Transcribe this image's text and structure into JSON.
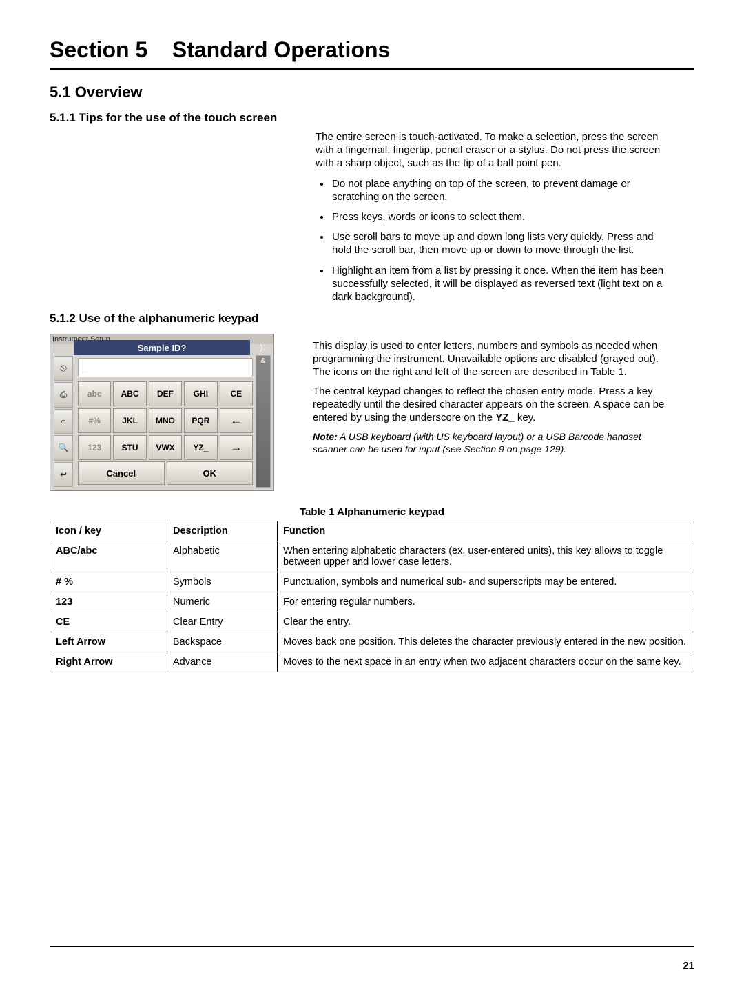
{
  "title_section": "Section 5",
  "title_main": "Standard Operations",
  "h1": "5.1  Overview",
  "s511": {
    "h": "5.1.1  Tips for the use of the touch screen",
    "p1": "The entire screen is touch-activated. To make a selection, press the screen with a fingernail, fingertip, pencil eraser or a stylus. Do not press the screen with a sharp object, such as the tip of a ball point pen.",
    "li1": "Do not place anything on top of the screen, to prevent damage or scratching on the screen.",
    "li2": "Press keys, words or icons to select them.",
    "li3": "Use scroll bars to move up and down long lists very quickly. Press and hold the scroll bar, then move up or down to move through the list.",
    "li4": "Highlight an item from a list by pressing it once. When the item has been successfully selected, it will be displayed as reversed text (light text on a dark background)."
  },
  "s512": {
    "h": "5.1.2  Use of the alphanumeric keypad",
    "p1": "This display is used to enter letters, numbers and symbols as needed when programming the instrument. Unavailable options are disabled (grayed out). The icons on the right and left of the screen are described in Table 1.",
    "p2a": "The central keypad changes to reflect the chosen entry mode. Press a key repeatedly until the desired character appears on the screen. A space can be entered by using the underscore on the ",
    "p2b": "YZ_",
    "p2c": " key.",
    "note_lead": "Note:",
    "note_body": " A USB keyboard (with US keyboard layout) or a USB Barcode handset scanner can be used for input (see Section 9 on page 129)."
  },
  "keypad": {
    "scrim": "Instrument Setup",
    "header": "Sample ID?",
    "hdr_r": "):",
    "right_col": "&",
    "input_value": "_",
    "keys": [
      [
        "abc",
        "ABC",
        "DEF",
        "GHI",
        "CE"
      ],
      [
        "#%",
        "JKL",
        "MNO",
        "PQR",
        "←"
      ],
      [
        "123",
        "STU",
        "VWX",
        "YZ_",
        "→"
      ]
    ],
    "cancel": "Cancel",
    "ok": "OK",
    "left_icons": [
      "⎋",
      "⎙",
      "○",
      "🔍",
      "↩"
    ]
  },
  "table": {
    "caption": "Table 1  Alphanumeric keypad",
    "head": {
      "c1": "Icon / key",
      "c2": "Description",
      "c3": "Function"
    },
    "rows": [
      {
        "c1": "ABC/abc",
        "c2": "Alphabetic",
        "c3": "When entering alphabetic characters (ex. user-entered units), this key allows to toggle between upper and lower case letters."
      },
      {
        "c1": "# %",
        "c2": "Symbols",
        "c3": "Punctuation, symbols and numerical sub- and superscripts may be entered."
      },
      {
        "c1": "123",
        "c2": "Numeric",
        "c3": "For entering regular numbers."
      },
      {
        "c1": "CE",
        "c2": "Clear Entry",
        "c3": "Clear the entry."
      },
      {
        "c1": "Left Arrow",
        "c2": "Backspace",
        "c3": "Moves back one position. This deletes the character previously entered in the new position."
      },
      {
        "c1": "Right Arrow",
        "c2": "Advance",
        "c3": "Moves to the next space in an entry when two adjacent characters occur on the same key."
      }
    ]
  },
  "page_number": "21"
}
